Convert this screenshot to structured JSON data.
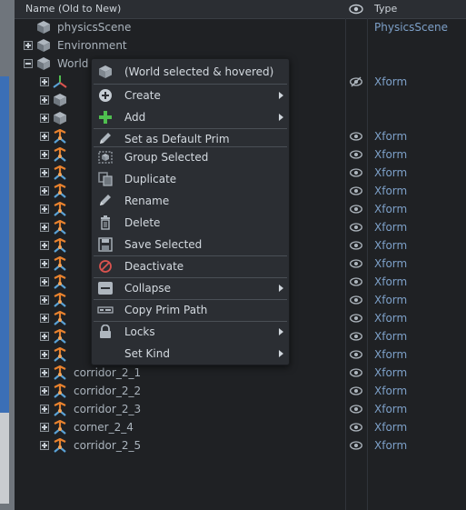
{
  "header": {
    "name_label": "Name (Old to New)",
    "type_label": "Type"
  },
  "rows": [
    {
      "label": "physicsScene",
      "type": "PhysicsScene",
      "icon": "cube-icon"
    },
    {
      "label": "Environment",
      "type": "",
      "icon": "cube-icon"
    },
    {
      "label": "World",
      "type": "",
      "icon": "cube-icon"
    },
    {
      "label": "",
      "type": "Xform",
      "icon": "axis-icon"
    },
    {
      "label": "",
      "type": "",
      "icon": "cube-icon"
    },
    {
      "label": "",
      "type": "",
      "icon": "cube-icon"
    },
    {
      "label": "",
      "type": "Xform",
      "icon": "xform-icon"
    },
    {
      "label": "",
      "type": "Xform",
      "icon": "xform-icon"
    },
    {
      "label": "",
      "type": "Xform",
      "icon": "xform-icon"
    },
    {
      "label": "",
      "type": "Xform",
      "icon": "xform-icon"
    },
    {
      "label": "",
      "type": "Xform",
      "icon": "xform-icon"
    },
    {
      "label": "",
      "type": "Xform",
      "icon": "xform-icon"
    },
    {
      "label": "",
      "type": "Xform",
      "icon": "xform-icon"
    },
    {
      "label": "",
      "type": "Xform",
      "icon": "xform-icon"
    },
    {
      "label": "",
      "type": "Xform",
      "icon": "xform-icon"
    },
    {
      "label": "",
      "type": "Xform",
      "icon": "xform-icon"
    },
    {
      "label": "",
      "type": "Xform",
      "icon": "xform-icon"
    },
    {
      "label": "",
      "type": "Xform",
      "icon": "xform-icon"
    },
    {
      "label": "",
      "type": "Xform",
      "icon": "xform-icon"
    },
    {
      "label": "corridor_2_1",
      "type": "Xform",
      "icon": "xform-icon"
    },
    {
      "label": "corridor_2_2",
      "type": "Xform",
      "icon": "xform-icon"
    },
    {
      "label": "corridor_2_3",
      "type": "Xform",
      "icon": "xform-icon"
    },
    {
      "label": "corner_2_4",
      "type": "Xform",
      "icon": "xform-icon"
    },
    {
      "label": "corridor_2_5",
      "type": "Xform",
      "icon": "xform-icon"
    }
  ],
  "context_menu": {
    "title": "(World selected & hovered)",
    "items": [
      {
        "label": "Create",
        "icon": "plus-circle-icon"
      },
      {
        "label": "Add",
        "icon": "plus-icon"
      },
      {
        "label": "Set as Default Prim",
        "icon": "pencil-icon"
      },
      {
        "label": "Group Selected",
        "icon": "group-icon"
      },
      {
        "label": "Duplicate",
        "icon": "duplicate-icon"
      },
      {
        "label": "Rename",
        "icon": "pencil-icon"
      },
      {
        "label": "Delete",
        "icon": "trash-icon"
      },
      {
        "label": "Save Selected",
        "icon": "save-icon"
      },
      {
        "label": "Deactivate",
        "icon": "deactivate-icon"
      },
      {
        "label": "Collapse",
        "icon": "minus-box-icon"
      },
      {
        "label": "Copy Prim Path",
        "icon": "path-icon"
      },
      {
        "label": "Locks",
        "icon": "lock-icon"
      },
      {
        "label": "Set Kind",
        "icon": ""
      }
    ]
  },
  "colors": {
    "type_text": "#7da0c8",
    "menu_bg": "#2b2e33",
    "panel_bg": "#1f2124",
    "xform_orange": "#e8822e",
    "xform_blue": "#5aa2d6"
  }
}
